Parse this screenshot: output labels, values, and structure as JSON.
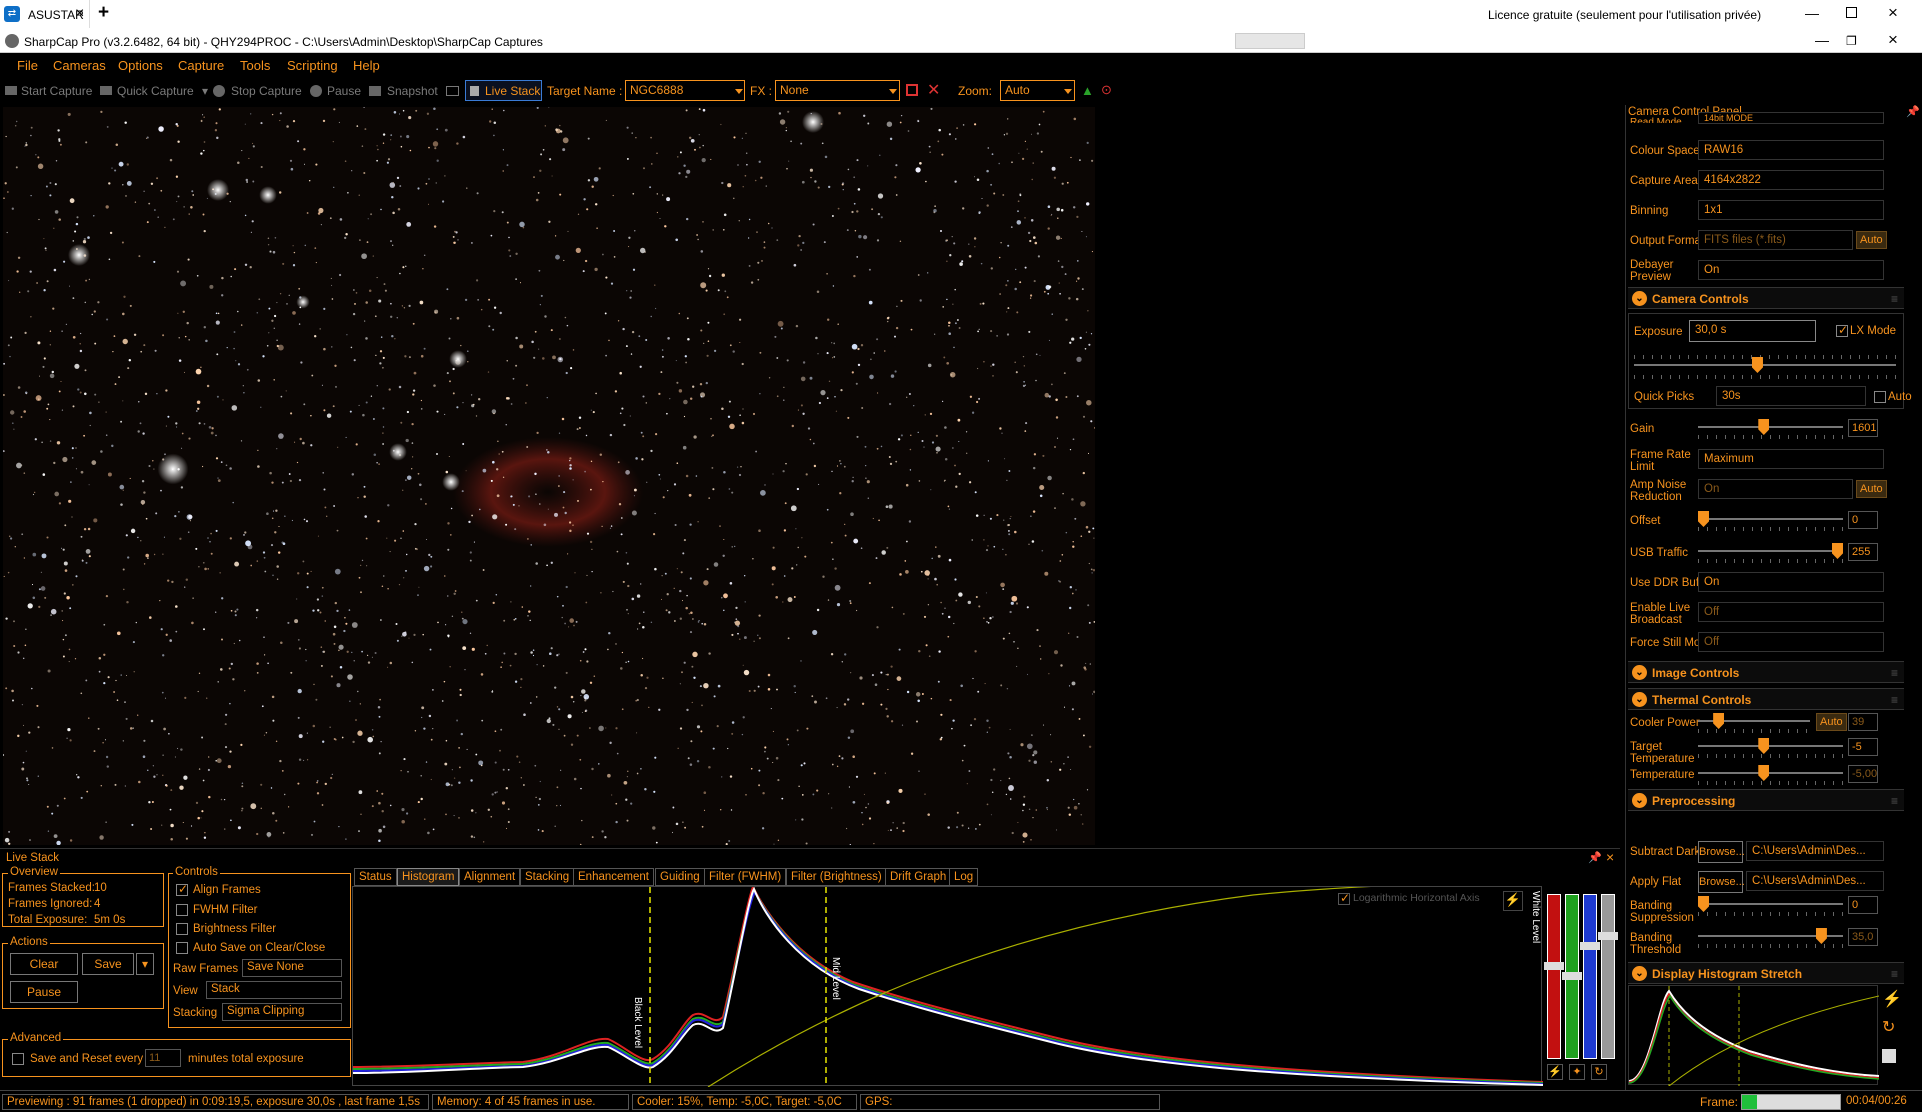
{
  "tabbar": {
    "tab_label": "ASUSTAR",
    "close": "×",
    "add": "+",
    "license": "Licence gratuite (seulement pour l'utilisation privée)"
  },
  "window": {
    "title": "SharpCap Pro (v3.2.6482, 64 bit) - QHY294PROC - C:\\Users\\Admin\\Desktop\\SharpCap Captures"
  },
  "menu": [
    "File",
    "Cameras",
    "Options",
    "Capture",
    "Tools",
    "Scripting",
    "Help"
  ],
  "toolbar": {
    "start_capture": "Start Capture",
    "quick_capture": "Quick Capture",
    "stop_capture": "Stop Capture",
    "pause": "Pause",
    "snapshot": "Snapshot",
    "live_stack": "Live Stack",
    "target_label": "Target Name :",
    "target_value": "NGC6888",
    "fx_label": "FX :",
    "fx_value": "None",
    "zoom_label": "Zoom:",
    "zoom_value": "Auto"
  },
  "panel": {
    "title": "Camera Control Panel",
    "read_mode": "Read Mode",
    "read_mode_value": "14bit MODE",
    "colour_space": "Colour Space",
    "colour_space_value": "RAW16",
    "capture_area": "Capture Area",
    "capture_area_value": "4164x2822",
    "binning": "Binning",
    "binning_value": "1x1",
    "output_format": "Output Format",
    "output_format_value": "FITS files (*.fits)",
    "auto": "Auto",
    "debayer_1": "Debayer",
    "debayer_2": "Preview",
    "debayer_value": "On",
    "camera_controls": "Camera Controls",
    "exposure": "Exposure",
    "exposure_value": "30,0 s",
    "lx_mode": "LX Mode",
    "exposure_level": 0.47,
    "quick_picks": "Quick Picks",
    "quick_picks_value": "30s",
    "gain": "Gain",
    "gain_value": "1601",
    "gain_level": 0.45,
    "frame_rate_1": "Frame Rate",
    "frame_rate_2": "Limit",
    "frame_rate_value": "Maximum",
    "amp_1": "Amp Noise",
    "amp_2": "Reduction",
    "amp_value": "On",
    "offset": "Offset",
    "offset_value": "0",
    "offset_level": 0.0,
    "usb": "USB Traffic",
    "usb_value": "255",
    "usb_level": 1.0,
    "ddr": "Use DDR Buffer",
    "ddr_value": "On",
    "live_1": "Enable Live",
    "live_2": "Broadcast",
    "live_value": "Off",
    "force_still": "Force Still Mode",
    "force_still_value": "Off",
    "image_controls": "Image Controls",
    "thermal_controls": "Thermal Controls",
    "cooler_power": "Cooler Power",
    "cooler_value": "39",
    "cooler_level": 0.15,
    "target_temp_1": "Target",
    "target_temp_2": "Temperature",
    "target_temp_value": "-5",
    "target_temp_level": 0.45,
    "temperature": "Temperature",
    "temperature_value": "-5,00",
    "temperature_level": 0.45,
    "preprocessing": "Preprocessing",
    "subtract_dark": "Subtract Dark",
    "browse": "Browse...",
    "dark_path": "C:\\Users\\Admin\\Des...",
    "apply_flat": "Apply Flat",
    "flat_path": "C:\\Users\\Admin\\Des...",
    "banding_supp_1": "Banding",
    "banding_supp_2": "Suppression",
    "banding_supp_value": "0",
    "banding_supp_level": 0.0,
    "banding_thr_1": "Banding",
    "banding_thr_2": "Threshold",
    "banding_thr_value": "35,0",
    "banding_thr_level": 0.88,
    "display_histogram": "Display Histogram Stretch"
  },
  "livestack": {
    "title": "Live Stack",
    "overview": "Overview",
    "frames_stacked_label": "Frames Stacked:",
    "frames_stacked": "10",
    "frames_ignored_label": "Frames Ignored:",
    "frames_ignored": "4",
    "total_exposure_label": "Total Exposure:",
    "total_exposure": "5m 0s",
    "actions": "Actions",
    "clear": "Clear",
    "save": "Save",
    "pause": "Pause",
    "controls": "Controls",
    "align": "Align Frames",
    "fwhm": "FWHM Filter",
    "brightness": "Brightness Filter",
    "autosave": "Auto Save on Clear/Close",
    "raw_frames": "Raw Frames",
    "raw_frames_value": "Save None",
    "view": "View",
    "view_value": "Stack",
    "stacking": "Stacking",
    "stacking_value": "Sigma Clipping",
    "advanced": "Advanced",
    "save_reset": "Save and Reset every",
    "save_reset_value": "11",
    "minutes": "minutes total exposure",
    "tabs": [
      "Status",
      "Histogram",
      "Alignment",
      "Stacking",
      "Enhancement",
      "Guiding",
      "Filter (FWHM)",
      "Filter (Brightness)",
      "Drift Graph",
      "Log"
    ],
    "log_axis": "Logarithmic Horizontal Axis",
    "black_level": "Black Level",
    "mid_level": "Mid Level",
    "white_level": "White Level"
  },
  "status": {
    "preview": "Previewing : 91 frames (1 dropped) in 0:09:19,5, exposure 30,0s , last frame 1,5s",
    "memory": "Memory: 4 of 45 frames in use.",
    "cooler": "Cooler: 15%, Temp: -5,0C, Target: -5,0C",
    "gps": "GPS:",
    "frame_label": "Frame:",
    "time": "00:04/00:26",
    "frame_progress": 0.15
  },
  "colors": {
    "accent": "#f7931e",
    "background": "#000000"
  }
}
